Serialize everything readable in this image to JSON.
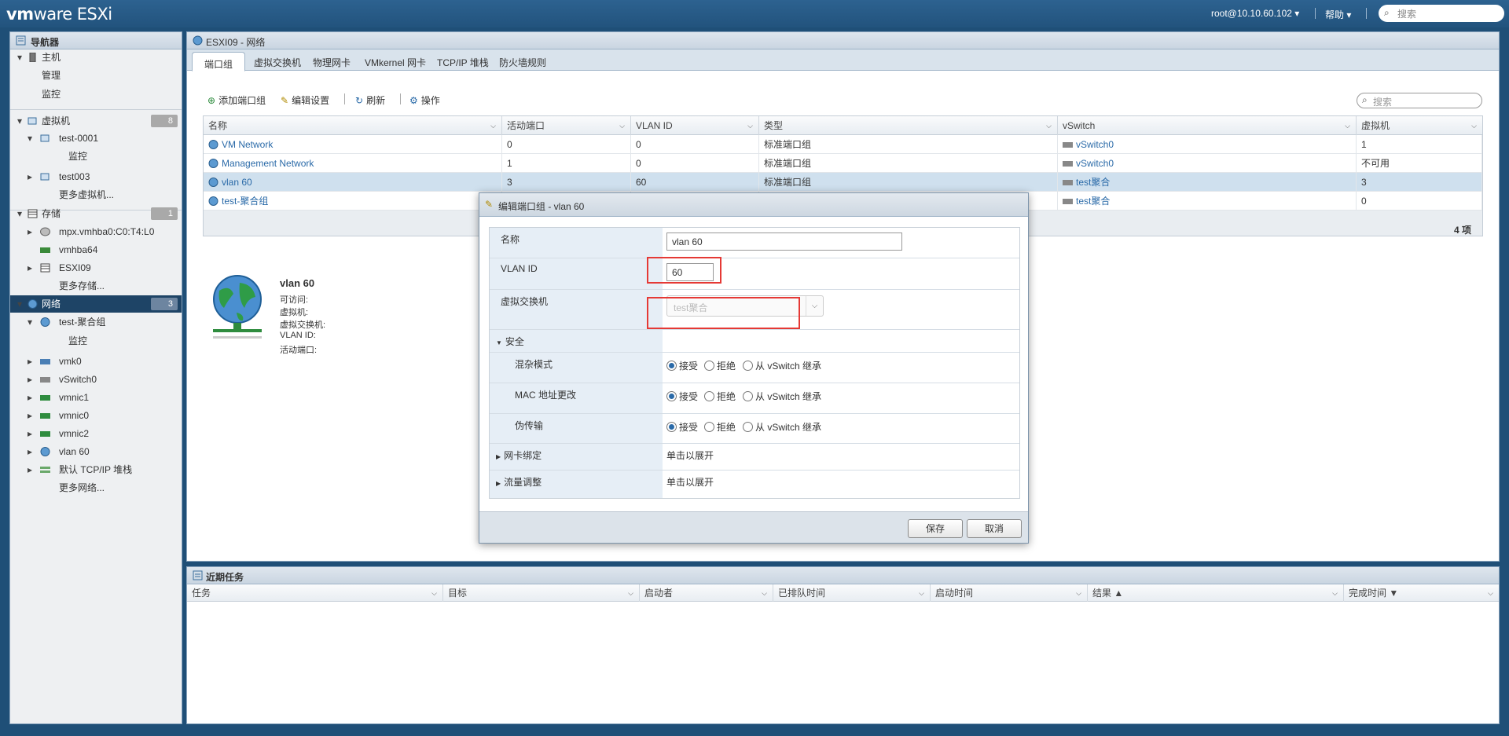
{
  "topbar": {
    "brand": "vm",
    "brand2": "ware",
    "product": "ESXi",
    "user": "root@10.10.60.102 ▾",
    "help": "帮助 ▾",
    "search_placeholder": "搜索"
  },
  "nav": {
    "title": "导航器",
    "items": [
      {
        "label": "主机"
      },
      {
        "label": "管理"
      },
      {
        "label": "监控"
      },
      {
        "label": "虚拟机",
        "badge": "8"
      },
      {
        "label": "test-0001"
      },
      {
        "label": "监控"
      },
      {
        "label": "test003"
      },
      {
        "label": "更多虚拟机..."
      },
      {
        "label": "存储",
        "badge": "1"
      },
      {
        "label": "mpx.vmhba0:C0:T4:L0"
      },
      {
        "label": "vmhba64"
      },
      {
        "label": "ESXI09"
      },
      {
        "label": "更多存储..."
      },
      {
        "label": "网络",
        "badge": "3"
      },
      {
        "label": "test-聚合组"
      },
      {
        "label": "监控"
      },
      {
        "label": "vmk0"
      },
      {
        "label": "vSwitch0"
      },
      {
        "label": "vmnic1"
      },
      {
        "label": "vmnic0"
      },
      {
        "label": "vmnic2"
      },
      {
        "label": "vlan 60"
      },
      {
        "label": "默认 TCP/IP 堆栈"
      },
      {
        "label": "更多网络..."
      }
    ]
  },
  "main": {
    "title": "ESXI09 - 网络",
    "tabs": [
      "端口组",
      "虚拟交换机",
      "物理网卡",
      "VMkernel 网卡",
      "TCP/IP 堆栈",
      "防火墙规则"
    ],
    "toolbar": {
      "add": "添加端口组",
      "edit": "编辑设置",
      "refresh": "刷新",
      "actions": "操作",
      "search_placeholder": "搜索"
    },
    "columns": [
      "名称",
      "活动端口",
      "VLAN ID",
      "类型",
      "vSwitch",
      "虚拟机"
    ],
    "rows": [
      [
        "VM Network",
        "0",
        "0",
        "标准端口组",
        "vSwitch0",
        "1"
      ],
      [
        "Management Network",
        "1",
        "0",
        "标准端口组",
        "vSwitch0",
        "不可用"
      ],
      [
        "vlan 60",
        "3",
        "60",
        "标准端口组",
        "test聚合",
        "3"
      ],
      [
        "test-聚合组",
        "",
        "",
        "",
        "test聚合",
        "0"
      ]
    ],
    "count": "4 项",
    "detail": {
      "name": "vlan 60",
      "labels": [
        "可访问:",
        "虚拟机:",
        "虚拟交换机:",
        "VLAN ID:",
        "活动端口:"
      ]
    }
  },
  "recent": {
    "title": "近期任务",
    "columns": [
      "任务",
      "目标",
      "启动者",
      "已排队时间",
      "启动时间",
      "结果 ▲",
      "完成时间 ▼"
    ]
  },
  "dialog": {
    "title": "编辑端口组 - vlan 60",
    "name_label": "名称",
    "name_value": "vlan 60",
    "vlan_label": "VLAN ID",
    "vlan_value": "60",
    "vswitch_label": "虚拟交换机",
    "vswitch_value": "test聚合",
    "security_label": "安全",
    "promisc_label": "混杂模式",
    "mac_label": "MAC 地址更改",
    "forged_label": "伪传输",
    "opt_accept": "接受",
    "opt_reject": "拒绝",
    "opt_inherit": "从 vSwitch 继承",
    "nic_label": "网卡绑定",
    "nic_value": "单击以展开",
    "shaping_label": "流量调整",
    "shaping_value": "单击以展开",
    "save": "保存",
    "cancel": "取消"
  }
}
